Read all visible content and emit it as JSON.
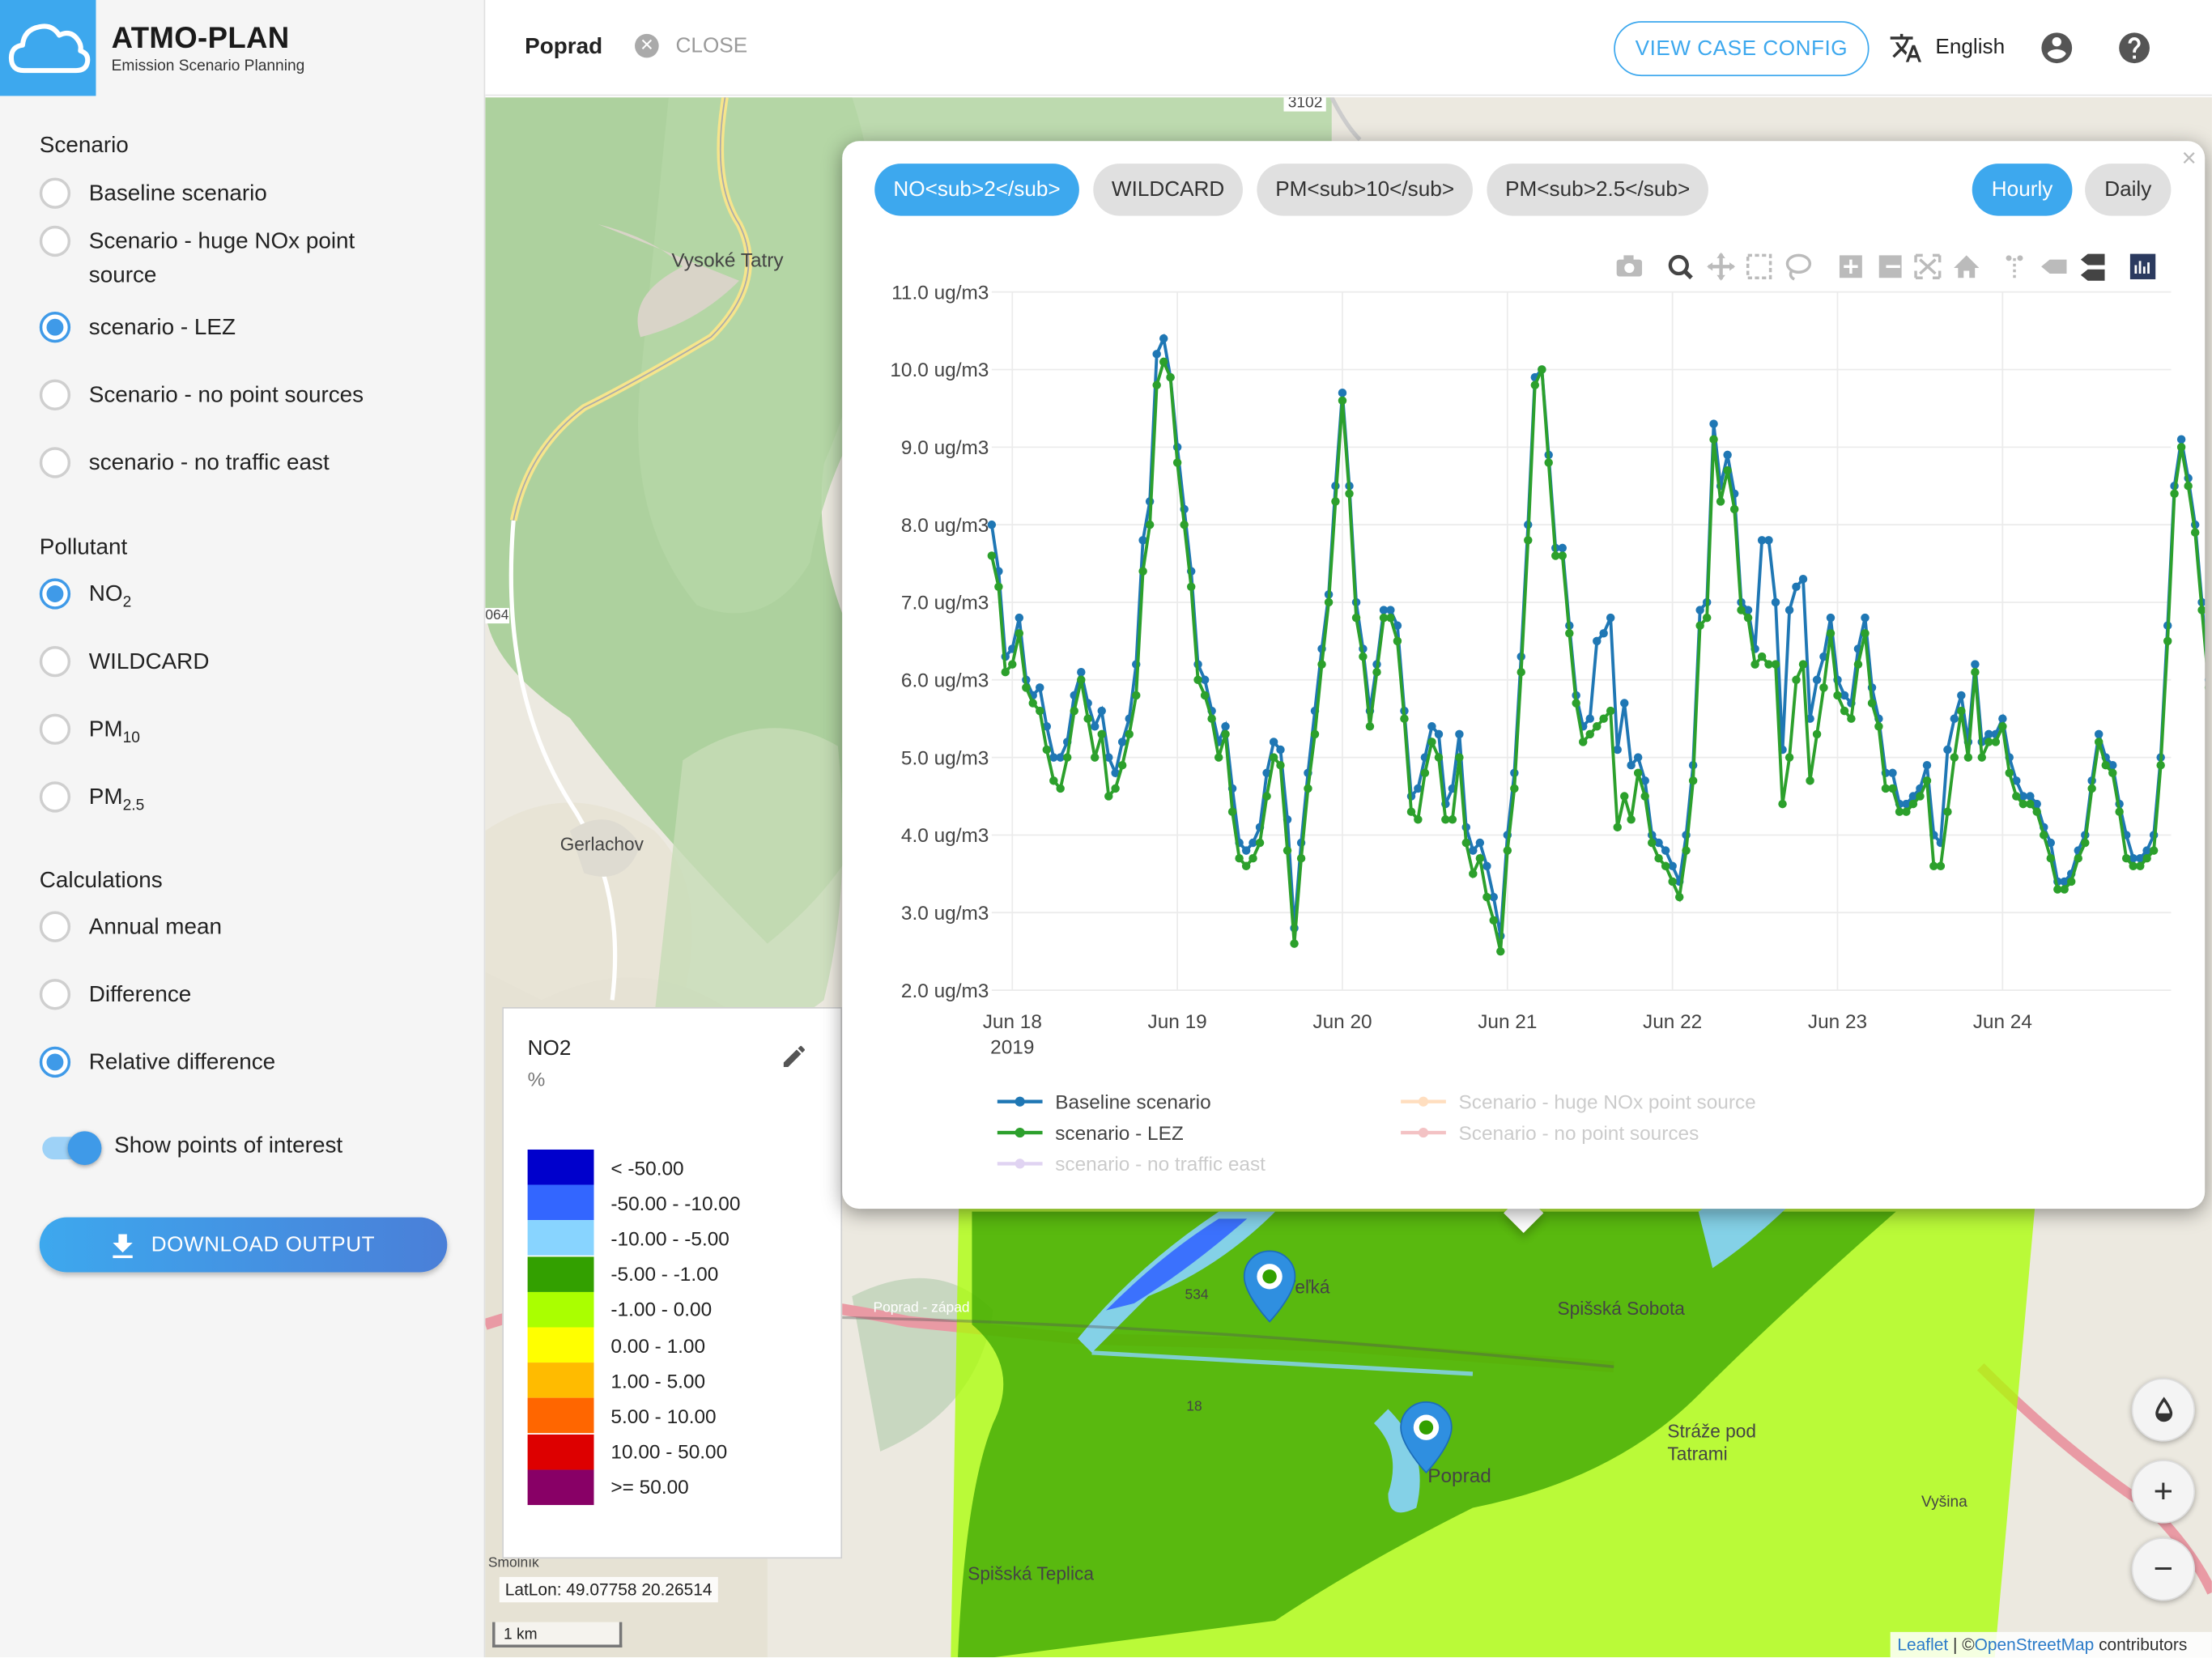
{
  "app": {
    "title": "ATMO-PLAN",
    "subtitle": "Emission Scenario Planning"
  },
  "sidebar": {
    "scenario_title": "Scenario",
    "scenarios": [
      {
        "label": "Baseline scenario",
        "selected": false
      },
      {
        "label": "Scenario - huge NOx point source",
        "selected": false
      },
      {
        "label": "scenario - LEZ",
        "selected": true
      },
      {
        "label": "Scenario - no point sources",
        "selected": false
      },
      {
        "label": "scenario - no traffic east",
        "selected": false
      }
    ],
    "pollutant_title": "Pollutant",
    "pollutants": [
      {
        "base": "NO",
        "sub": "2",
        "selected": true
      },
      {
        "base": "WILDCARD",
        "sub": "",
        "selected": false
      },
      {
        "base": "PM",
        "sub": "10",
        "selected": false
      },
      {
        "base": "PM",
        "sub": "2.5",
        "selected": false
      }
    ],
    "calculations_title": "Calculations",
    "calculations": [
      {
        "label": "Annual mean",
        "selected": false
      },
      {
        "label": "Difference",
        "selected": false
      },
      {
        "label": "Relative difference",
        "selected": true
      }
    ],
    "show_poi_label": "Show points of interest",
    "show_poi_on": true,
    "download_label": "DOWNLOAD OUTPUT"
  },
  "topbar": {
    "location": "Poprad",
    "close_label": "CLOSE",
    "view_case_label": "VIEW CASE CONFIG",
    "language": "English"
  },
  "map": {
    "labels": [
      "Vysoké Tatry",
      "Gerlachov",
      "Spišská Sobota",
      "Poprad",
      "Spišská Teplica",
      "Veľká",
      "Stráže pod Tatrami",
      "Vyšina",
      "3102",
      "534",
      "18",
      "064",
      "Smolník",
      "Poprad - západ"
    ],
    "latlon": "LatLon: 49.07758 20.26514",
    "scale": "1 km",
    "attribution_leaflet": "Leaflet",
    "attribution_sep": " | ©",
    "attribution_osm": "OpenStreetMap",
    "attribution_tail": " contributors"
  },
  "legend": {
    "title": "NO2",
    "unit": "%",
    "items": [
      {
        "label": "< -50.00",
        "color": "#0000cc"
      },
      {
        "label": "-50.00 - -10.00",
        "color": "#3366ff"
      },
      {
        "label": "-10.00 - -5.00",
        "color": "#88d4ff"
      },
      {
        "label": "-5.00 - -1.00",
        "color": "#33a000"
      },
      {
        "label": "-1.00 - 0.00",
        "color": "#aaff00"
      },
      {
        "label": "0.00 - 1.00",
        "color": "#ffff00"
      },
      {
        "label": "1.00 - 5.00",
        "color": "#ffbb00"
      },
      {
        "label": "5.00 - 10.00",
        "color": "#ff6600"
      },
      {
        "label": "10.00 - 50.00",
        "color": "#dd0000"
      },
      {
        "label": ">= 50.00",
        "color": "#880066"
      }
    ]
  },
  "popup": {
    "pollutant_tabs": [
      "NO<sub>2</sub>",
      "WILDCARD",
      "PM<sub>10</sub>",
      "PM<sub>2.5</sub>"
    ],
    "active_tab": 0,
    "resolution_tabs": [
      "Hourly",
      "Daily"
    ],
    "active_resolution": 0,
    "close_symbol": "×"
  },
  "chart_data": {
    "type": "line",
    "title": "",
    "xlabel": "",
    "ylabel": "",
    "x_start": "2019-06-17 21:00",
    "x_step_hours": 1,
    "xlim": [
      "2019-06-17 21:00",
      "2019-06-25 00:30"
    ],
    "ylim": [
      2.0,
      11.0
    ],
    "y_ticks": [
      "2.0 ug/m3",
      "3.0 ug/m3",
      "4.0 ug/m3",
      "5.0 ug/m3",
      "6.0 ug/m3",
      "7.0 ug/m3",
      "8.0 ug/m3",
      "9.0 ug/m3",
      "10.0 ug/m3",
      "11.0 ug/m3"
    ],
    "x_ticks": [
      "Jun 18",
      "Jun 19",
      "Jun 20",
      "Jun 21",
      "Jun 22",
      "Jun 23",
      "Jun 24"
    ],
    "x_year_label": "2019",
    "grid": true,
    "legend_position": "bottom",
    "series": [
      {
        "name": "Baseline scenario",
        "color": "#1f77b4",
        "visible": true,
        "values": [
          8.0,
          7.4,
          6.3,
          6.4,
          6.8,
          6.0,
          5.8,
          5.9,
          5.4,
          5.0,
          5.0,
          5.2,
          5.8,
          6.1,
          5.7,
          5.4,
          5.6,
          5.0,
          4.8,
          5.2,
          5.5,
          6.2,
          7.8,
          8.3,
          10.2,
          10.4,
          9.9,
          9.0,
          8.2,
          7.4,
          6.2,
          6.0,
          5.6,
          5.2,
          5.4,
          4.6,
          3.9,
          3.8,
          3.9,
          4.1,
          4.8,
          5.2,
          5.1,
          4.2,
          2.8,
          3.9,
          4.8,
          5.6,
          6.4,
          7.1,
          8.5,
          9.7,
          8.5,
          7.0,
          6.4,
          5.6,
          6.2,
          6.9,
          6.9,
          6.7,
          5.6,
          4.5,
          4.6,
          5.0,
          5.4,
          5.3,
          4.4,
          4.6,
          5.3,
          4.1,
          3.8,
          3.9,
          3.6,
          3.2,
          2.7,
          4.0,
          4.8,
          6.3,
          8.0,
          9.9,
          10.0,
          8.9,
          7.7,
          7.7,
          6.7,
          5.8,
          5.4,
          5.5,
          6.5,
          6.6,
          6.8,
          5.1,
          5.7,
          4.9,
          5.0,
          4.7,
          4.0,
          3.9,
          3.8,
          3.6,
          3.4,
          4.0,
          4.9,
          6.9,
          7.0,
          9.3,
          8.5,
          8.9,
          8.4,
          7.0,
          6.9,
          6.4,
          7.8,
          7.8,
          7.0,
          5.1,
          6.9,
          7.2,
          7.3,
          5.5,
          6.0,
          6.3,
          6.8,
          6.0,
          5.8,
          5.7,
          6.4,
          6.8,
          5.9,
          5.5,
          4.8,
          4.8,
          4.4,
          4.4,
          4.5,
          4.6,
          4.9,
          4.0,
          3.9,
          5.1,
          5.5,
          5.8,
          5.2,
          6.2,
          5.2,
          5.3,
          5.3,
          5.5,
          5.0,
          4.7,
          4.5,
          4.5,
          4.4,
          4.1,
          3.9,
          3.4,
          3.4,
          3.5,
          3.8,
          4.0,
          4.7,
          5.3,
          5.0,
          4.9,
          4.4,
          4.0,
          3.7,
          3.7,
          3.8,
          4.0,
          5.0,
          6.7,
          8.5,
          9.1,
          8.6,
          8.0,
          7.0,
          6.0,
          5.7,
          5.2,
          5.0,
          5.5,
          5.3,
          5.0,
          4.7,
          5.0,
          5.3
        ]
      },
      {
        "name": "Scenario - huge NOx point source",
        "color": "#ffbf80",
        "visible": false
      },
      {
        "name": "scenario - LEZ",
        "color": "#2ca02c",
        "visible": true,
        "values": [
          7.6,
          7.2,
          6.1,
          6.2,
          6.6,
          5.9,
          5.7,
          5.6,
          5.1,
          4.7,
          4.6,
          5.0,
          5.6,
          6.0,
          5.5,
          5.0,
          5.3,
          4.5,
          4.6,
          4.9,
          5.3,
          5.8,
          7.4,
          8.0,
          9.8,
          10.1,
          9.9,
          8.8,
          8.0,
          7.2,
          6.0,
          5.8,
          5.5,
          5.0,
          5.3,
          4.3,
          3.7,
          3.6,
          3.7,
          3.9,
          4.5,
          5.0,
          4.9,
          3.8,
          2.6,
          3.7,
          4.6,
          5.3,
          6.2,
          7.0,
          8.3,
          9.6,
          8.4,
          6.8,
          6.3,
          5.4,
          6.1,
          6.8,
          6.8,
          6.5,
          5.5,
          4.3,
          4.2,
          4.8,
          5.2,
          5.0,
          4.2,
          4.2,
          5.0,
          3.9,
          3.5,
          3.7,
          3.2,
          2.9,
          2.5,
          3.8,
          4.6,
          6.1,
          7.8,
          9.8,
          10.0,
          8.8,
          7.6,
          7.6,
          6.6,
          5.7,
          5.2,
          5.3,
          5.4,
          5.5,
          5.6,
          4.1,
          4.5,
          4.2,
          4.8,
          4.5,
          3.9,
          3.7,
          3.6,
          3.4,
          3.2,
          3.8,
          4.7,
          6.7,
          6.8,
          9.1,
          8.3,
          8.7,
          8.2,
          6.9,
          6.8,
          6.2,
          6.3,
          6.2,
          6.2,
          4.4,
          5.0,
          6.0,
          6.2,
          4.7,
          5.3,
          5.9,
          6.6,
          5.8,
          5.6,
          5.5,
          6.2,
          6.6,
          5.7,
          5.4,
          4.6,
          4.6,
          4.3,
          4.3,
          4.4,
          4.5,
          4.7,
          3.6,
          3.6,
          4.3,
          5.0,
          5.6,
          5.0,
          6.1,
          5.0,
          5.2,
          5.2,
          5.4,
          4.8,
          4.5,
          4.4,
          4.4,
          4.3,
          4.0,
          3.7,
          3.3,
          3.3,
          3.4,
          3.7,
          3.9,
          4.6,
          5.2,
          4.9,
          4.8,
          4.3,
          3.7,
          3.6,
          3.6,
          3.7,
          3.8,
          4.9,
          6.5,
          8.4,
          9.0,
          8.5,
          7.9,
          6.9,
          5.9,
          5.6,
          5.0,
          4.9,
          5.4,
          5.2,
          4.8,
          4.4,
          4.4,
          5.1
        ]
      },
      {
        "name": "Scenario - no point sources",
        "color": "#e8868a",
        "visible": false
      },
      {
        "name": "scenario - no traffic east",
        "color": "#c3a9e6",
        "visible": false
      }
    ]
  }
}
